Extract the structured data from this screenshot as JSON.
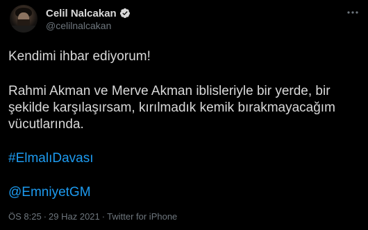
{
  "author": {
    "display_name": "Celil Nalcakan",
    "handle": "@celilnalcakan",
    "verified": true
  },
  "tweet": {
    "paragraph1": "Kendimi ihbar ediyorum!",
    "paragraph2_lines": [
      "Rahmi Akman ve Merve Akman iblisleriyle bir yerde, bir",
      "şekilde karşılaşırsam, kırılmadık kemik bırakmayacağım",
      "vücutlarında."
    ],
    "hashtag": "#ElmalıDavası",
    "mention": "@EmniyetGM"
  },
  "meta": {
    "time": "ÖS 8:25",
    "separator": "·",
    "date": "29 Haz 2021",
    "source": "Twitter for iPhone"
  },
  "colors": {
    "background": "#000000",
    "text": "#d9d9d9",
    "secondary": "#6e767d",
    "link": "#1d9bf0"
  },
  "icons": {
    "verified": "verified-badge-icon",
    "more": "more-options-icon"
  }
}
